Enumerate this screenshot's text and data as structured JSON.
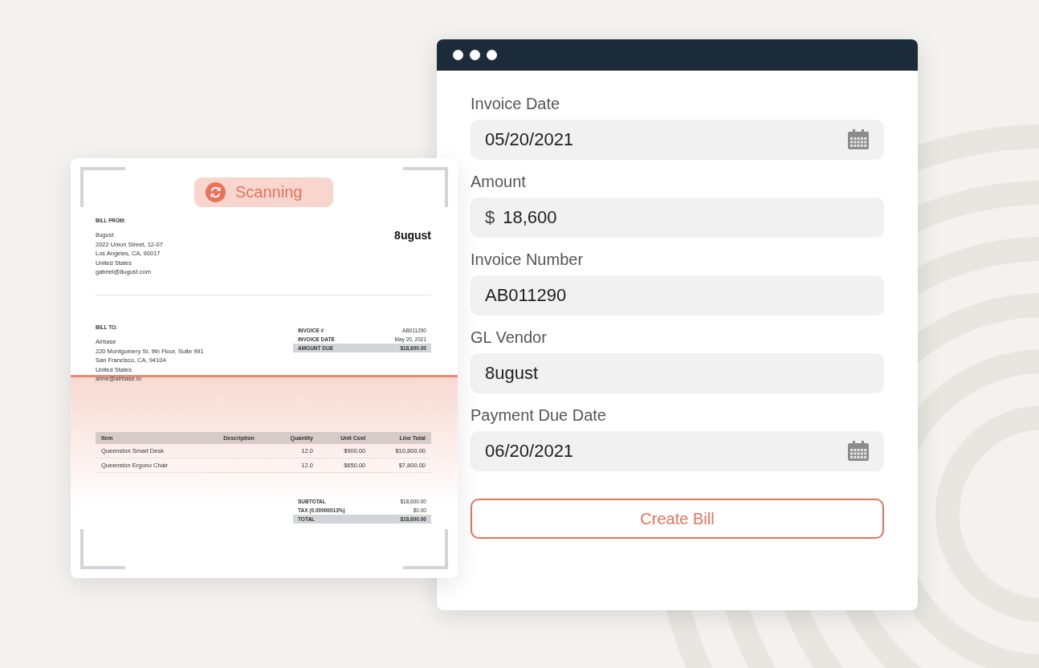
{
  "invoice": {
    "badge": "Scanning",
    "logo": "8ugust",
    "bill_from": {
      "heading": "BILL FROM:",
      "lines": [
        "8ugust",
        "2022 Union Street, 12-07",
        "Los Angeles, CA, 90017",
        "United States",
        "gabriel@8ugust.com"
      ]
    },
    "bill_to": {
      "heading": "BILL TO:",
      "lines": [
        "Airbase",
        "220 Montgomery St. 9th Floor, Suite 991",
        "San Francisco, CA, 94104",
        "United States",
        "anne@airbase.io"
      ]
    },
    "meta": [
      {
        "label": "INVOICE #",
        "value": "AB011290",
        "highlight": false
      },
      {
        "label": "INVOICE DATE",
        "value": "May 20, 2021",
        "highlight": false
      },
      {
        "label": "AMOUNT DUE",
        "value": "$18,600.00",
        "highlight": true
      }
    ],
    "table": {
      "columns": [
        "Item",
        "Description",
        "Quantity",
        "Unit Cost",
        "Line Total"
      ],
      "rows": [
        [
          "Queenston Smart Desk",
          "",
          "12.0",
          "$900.00",
          "$10,800.00"
        ],
        [
          "Queenston Ergono Chair",
          "",
          "12.0",
          "$650.00",
          "$7,800.00"
        ]
      ]
    },
    "totals": [
      {
        "label": "SUBTOTAL",
        "value": "$18,600.00",
        "highlight": false
      },
      {
        "label": "TAX (0.00000013%)",
        "value": "$0.00",
        "highlight": false
      },
      {
        "label": "TOTAL",
        "value": "$18,600.00",
        "highlight": true
      }
    ]
  },
  "form": {
    "fields": [
      {
        "label": "Invoice Date",
        "value": "05/20/2021",
        "kind": "date"
      },
      {
        "label": "Amount",
        "prefix": "$",
        "value": "18,600",
        "kind": "money"
      },
      {
        "label": "Invoice Number",
        "value": "AB011290",
        "kind": "text"
      },
      {
        "label": "GL Vendor",
        "value": "8ugust",
        "kind": "text"
      },
      {
        "label": "Payment Due Date",
        "value": "06/20/2021",
        "kind": "date"
      }
    ],
    "button": "Create Bill"
  }
}
